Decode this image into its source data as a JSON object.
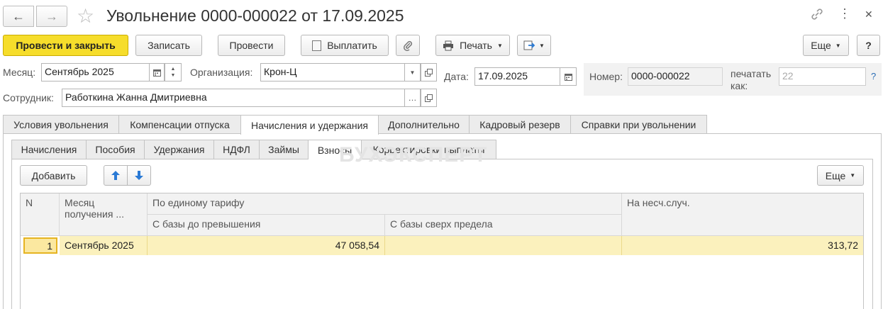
{
  "window": {
    "title": "Увольнение 0000-000022 от 17.09.2025",
    "back_icon": "←",
    "forward_icon": "→",
    "star_icon": "☆",
    "link_icon": "🔗",
    "more_icon": "⋮",
    "close_icon": "✕"
  },
  "toolbar": {
    "post_and_close": "Провести и закрыть",
    "save": "Записать",
    "post": "Провести",
    "pay": "Выплатить",
    "print": "Печать",
    "more": "Еще",
    "help": "?"
  },
  "form": {
    "month_label": "Месяц:",
    "month_value": "Сентябрь 2025",
    "org_label": "Организация:",
    "org_value": "Крон-Ц",
    "date_label": "Дата:",
    "date_value": "17.09.2025",
    "number_label": "Номер:",
    "number_value": "0000-000022",
    "print_as_label_1": "печатать",
    "print_as_label_2": "как:",
    "print_as_value": "22",
    "help_mark": "?",
    "employee_label": "Сотрудник:",
    "employee_value": "Работкина Жанна Дмитриевна"
  },
  "tabs": [
    "Условия увольнения",
    "Компенсации отпуска",
    "Начисления и удержания",
    "Дополнительно",
    "Кадровый резерв",
    "Справки при увольнении"
  ],
  "subtabs": [
    "Начисления",
    "Пособия",
    "Удержания",
    "НДФЛ",
    "Займы",
    "Взносы",
    "Корректировки выплаты"
  ],
  "grid_toolbar": {
    "add": "Добавить",
    "up_icon": "🡅",
    "down_icon": "🡇",
    "more": "Еще"
  },
  "table": {
    "col_n": "N",
    "col_month": "Месяц получения ...",
    "col_single_tariff": "По единому тарифу",
    "col_base_before": "С базы до превышения",
    "col_base_over": "С базы сверх предела",
    "col_accident": "На несч.случ.",
    "rows": [
      {
        "n": "1",
        "month": "Сентябрь 2025",
        "base_before": "47 058,54",
        "base_over": "",
        "accident": "313,72"
      }
    ]
  },
  "watermark": "БУХЭКСПЕРТ"
}
